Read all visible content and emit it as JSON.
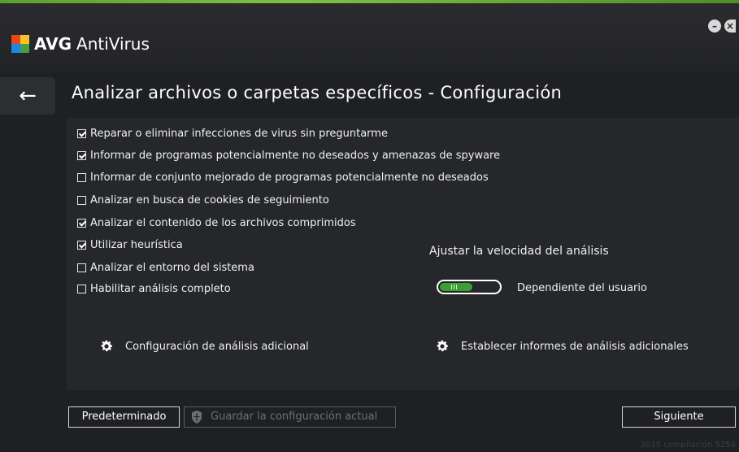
{
  "window": {
    "brand": "AVG",
    "product": "AntiVirus",
    "minimize": "–",
    "close": "×"
  },
  "page": {
    "back_icon": "←",
    "title": "Analizar archivos o carpetas específicos - Configuración"
  },
  "options": [
    {
      "label": "Reparar o eliminar infecciones de virus sin preguntarme",
      "checked": true
    },
    {
      "label": "Informar de programas potencialmente no deseados y amenazas de spyware",
      "checked": true
    },
    {
      "label": "Informar de conjunto mejorado de programas potencialmente no deseados",
      "checked": false
    },
    {
      "label": "Analizar en busca de cookies de seguimiento",
      "checked": false
    },
    {
      "label": "Analizar el contenido de los archivos comprimidos",
      "checked": true
    },
    {
      "label": "Utilizar heurística",
      "checked": true
    },
    {
      "label": "Analizar el entorno del sistema",
      "checked": false
    },
    {
      "label": "Habilitar análisis completo",
      "checked": false
    }
  ],
  "speed": {
    "label": "Ajustar la velocidad del análisis",
    "value_label": "Dependiente del usuario",
    "level_fraction": 0.25
  },
  "links": {
    "additional_settings": "Configuración de análisis adicional",
    "additional_reports": "Establecer informes de análisis adicionales"
  },
  "buttons": {
    "default": "Predeterminado",
    "save": "Guardar la configuración actual",
    "next": "Siguiente"
  },
  "footer": {
    "build": "2015  compilación 5256"
  },
  "colors": {
    "accent_green": "#3aa033",
    "background": "#1f2023"
  }
}
